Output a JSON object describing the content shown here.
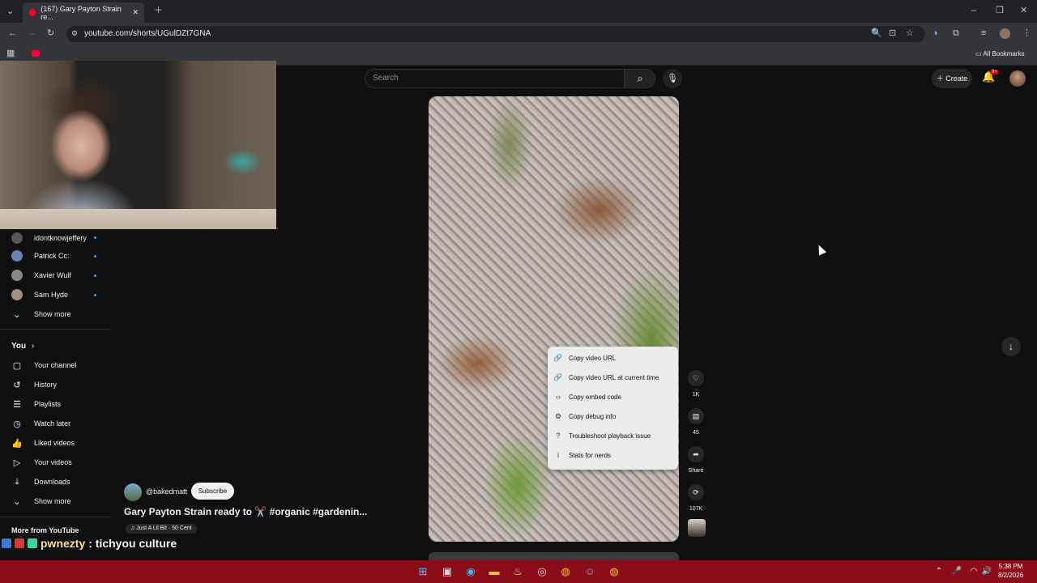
{
  "browser": {
    "tab_title": "(167) Gary Payton Strain re...",
    "url": "youtube.com/shorts/UGulDZt7GNA",
    "bookmarks_label": "All Bookmarks"
  },
  "header": {
    "search_placeholder": "Search",
    "create_label": "Create",
    "notif_badge": "9+"
  },
  "sidebar": {
    "subscriptions": [
      {
        "name": "idontknowjeffery",
        "color": "#555555"
      },
      {
        "name": "Patrick Cc:",
        "color": "#6b7fb0"
      },
      {
        "name": "Xavier Wulf",
        "color": "#888888"
      },
      {
        "name": "Sam Hyde",
        "color": "#a09080"
      }
    ],
    "show_more_1": "Show more",
    "you_heading": "You",
    "you_items": [
      {
        "label": "Your channel",
        "icon": "▢"
      },
      {
        "label": "History",
        "icon": "↺"
      },
      {
        "label": "Playlists",
        "icon": "☰"
      },
      {
        "label": "Watch later",
        "icon": "◷"
      },
      {
        "label": "Liked videos",
        "icon": "👍"
      },
      {
        "label": "Your videos",
        "icon": "▷"
      },
      {
        "label": "Downloads",
        "icon": "⤓"
      }
    ],
    "show_more_2": "Show more",
    "more_heading": "More from YouTube"
  },
  "video": {
    "channel": "@bakedmatt",
    "subscribe_label": "Subscribe",
    "title": "Gary Payton Strain ready to ✂️ #organic #gardenin...",
    "music": "♫ Just A Lil Bit · 50 Cent"
  },
  "context_menu": [
    {
      "label": "Copy video URL",
      "icon": "🔗"
    },
    {
      "label": "Copy video URL at current time",
      "icon": "🔗"
    },
    {
      "label": "Copy embed code",
      "icon": "‹›"
    },
    {
      "label": "Copy debug info",
      "icon": "⚙"
    },
    {
      "label": "Troubleshoot playback issue",
      "icon": "?"
    },
    {
      "label": "Stats for nerds",
      "icon": "i"
    }
  ],
  "actions": {
    "likes": "1K",
    "comments": "45",
    "share_label": "Share",
    "remix_count": "107K"
  },
  "chat": {
    "user": "pwnezty",
    "message": ": tichyou culture"
  },
  "taskbar": {
    "time": "5:38 PM",
    "date": "8/2/2026"
  }
}
